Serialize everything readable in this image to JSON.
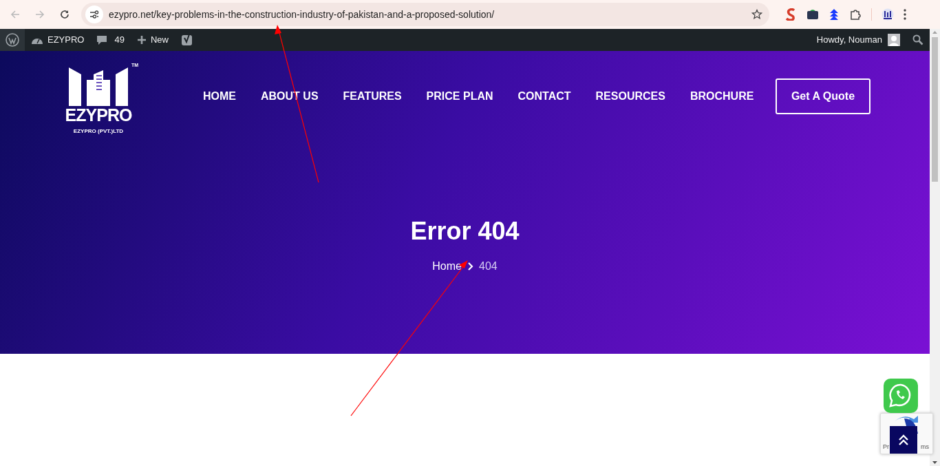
{
  "browser": {
    "url": "ezypro.net/key-problems-in-the-construction-industry-of-pakistan-and-a-proposed-solution/"
  },
  "admin_bar": {
    "site": "EZYPRO",
    "comments": "49",
    "new": "New",
    "greeting": "Howdy, Nouman"
  },
  "logo": {
    "wordmark": "EZYPRO",
    "company": "EZYPRO (PVT.)LTD",
    "trademark": "TM"
  },
  "nav": [
    {
      "label": "HOME"
    },
    {
      "label": "ABOUT US"
    },
    {
      "label": "FEATURES"
    },
    {
      "label": "PRICE PLAN"
    },
    {
      "label": "CONTACT"
    },
    {
      "label": "RESOURCES"
    },
    {
      "label": "BROCHURE"
    }
  ],
  "quote_button": "Get A Quote",
  "hero": {
    "title": "Error 404",
    "breadcrumb": [
      {
        "label": "Home"
      },
      {
        "label": "404"
      }
    ]
  },
  "recaptcha": {
    "text_start": "Pr",
    "text_end": "ms"
  }
}
